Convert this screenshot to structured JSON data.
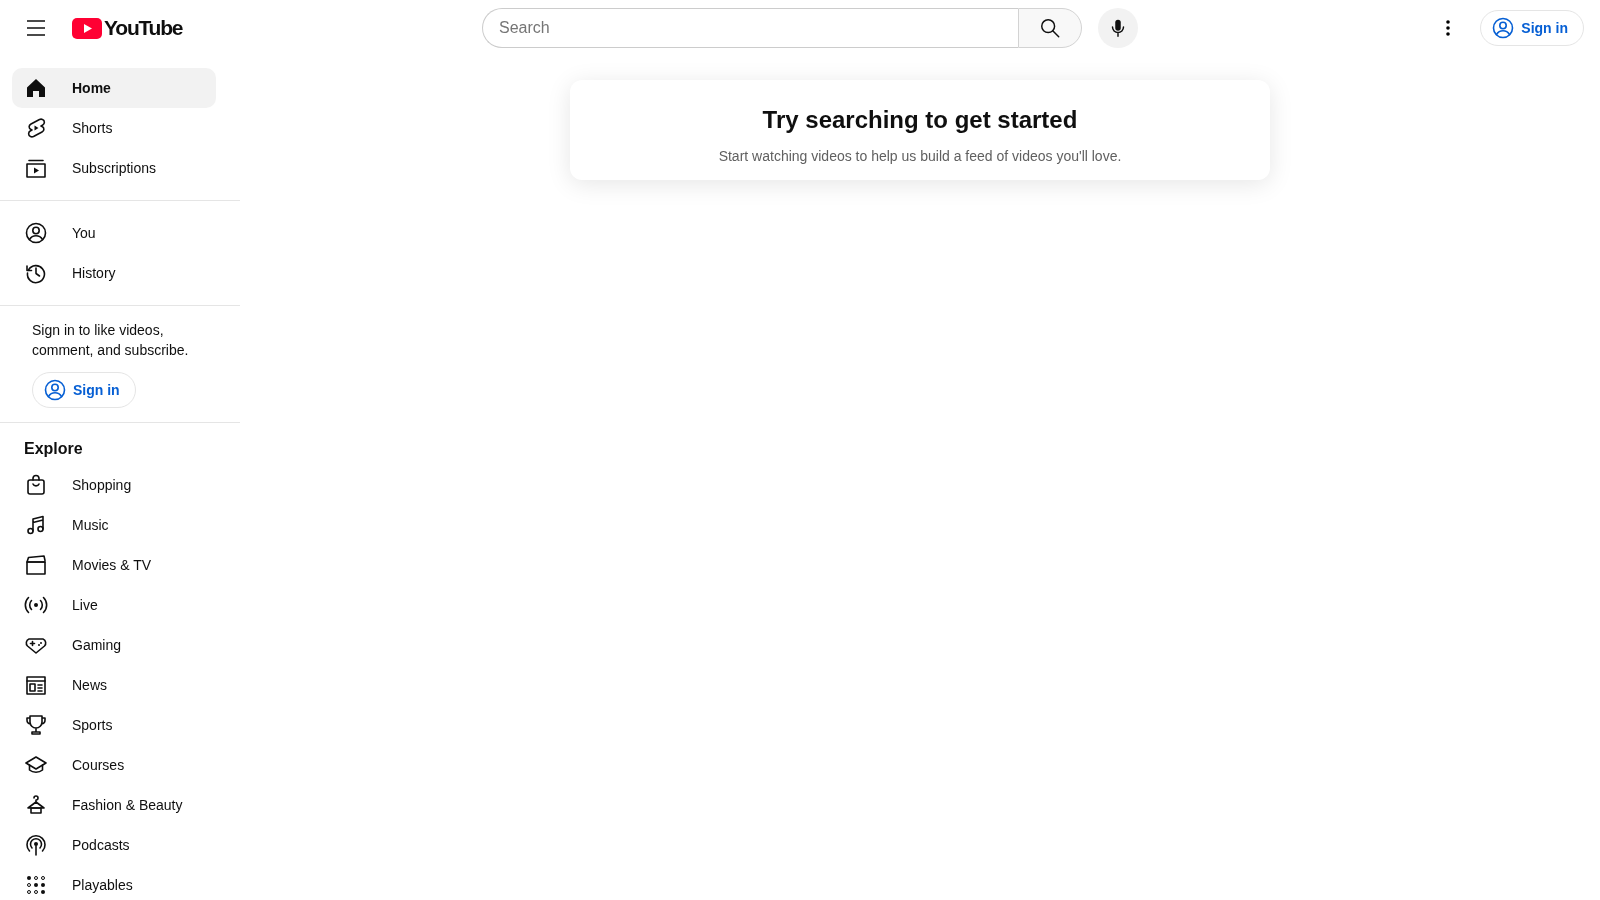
{
  "header": {
    "logo": "YouTube",
    "search": {
      "placeholder": "Search"
    },
    "sign_in": "Sign in"
  },
  "sidebar": {
    "sections": [
      {
        "items": [
          {
            "label": "Home",
            "selected": true
          },
          {
            "label": "Shorts",
            "selected": false
          },
          {
            "label": "Subscriptions",
            "selected": false
          }
        ]
      },
      {
        "items": [
          {
            "label": "You",
            "selected": false
          },
          {
            "label": "History",
            "selected": false
          }
        ]
      }
    ],
    "sign_in_prompt": {
      "text": "Sign in to like videos, comment, and subscribe.",
      "button": "Sign in"
    },
    "explore": {
      "heading": "Explore",
      "items": [
        {
          "label": "Shopping",
          "selected": false
        },
        {
          "label": "Music",
          "selected": false
        },
        {
          "label": "Movies & TV",
          "selected": false
        },
        {
          "label": "Live",
          "selected": false
        },
        {
          "label": "Gaming",
          "selected": false
        },
        {
          "label": "News",
          "selected": false
        },
        {
          "label": "Sports",
          "selected": false
        },
        {
          "label": "Courses",
          "selected": false
        },
        {
          "label": "Fashion & Beauty",
          "selected": false
        },
        {
          "label": "Podcasts",
          "selected": false
        },
        {
          "label": "Playables",
          "selected": false
        }
      ]
    }
  },
  "main": {
    "title": "Try searching to get started",
    "subtitle": "Start watching videos to help us build a feed of videos you'll love."
  }
}
